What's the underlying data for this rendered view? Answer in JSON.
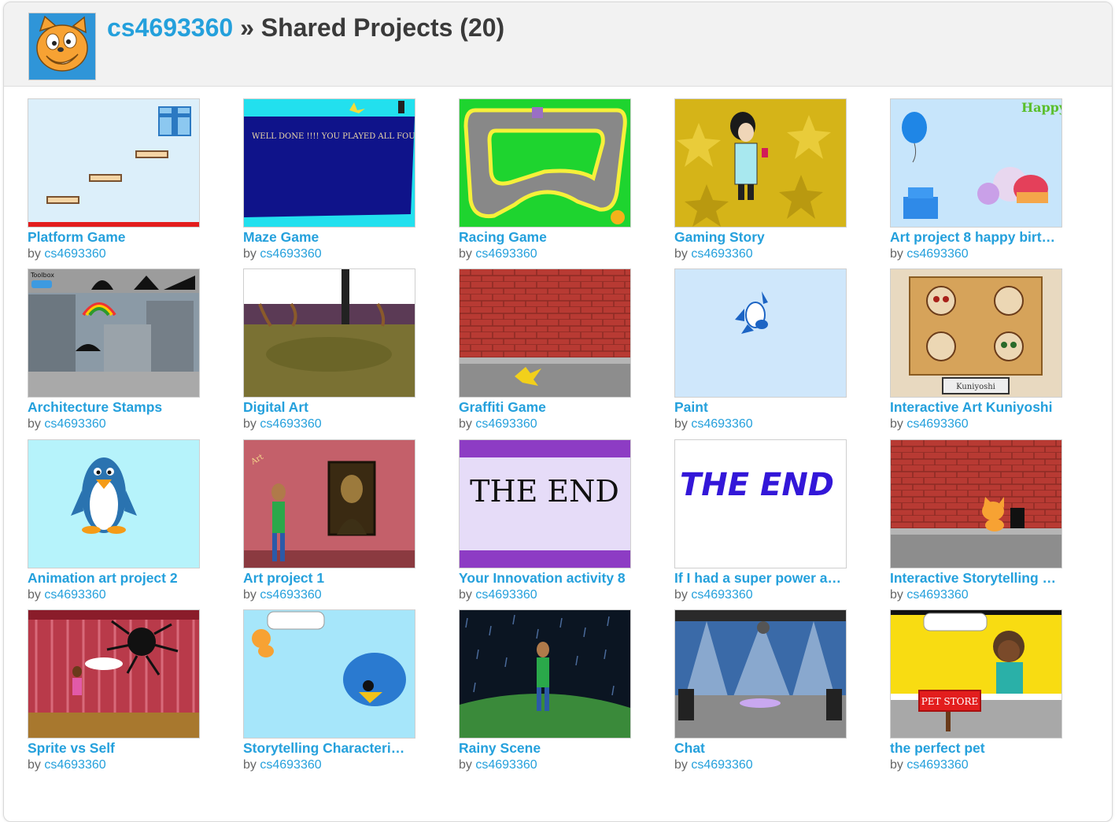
{
  "header": {
    "username": "cs4693360",
    "separator": " » ",
    "section_title": "Shared Projects (20)"
  },
  "projects": [
    {
      "title": "Platform Game",
      "by": "by",
      "owner": "cs4693360"
    },
    {
      "title": "Maze Game",
      "by": "by",
      "owner": "cs4693360",
      "thumb_text": "WELL DONE !!!! YOU PLAYED ALL FOUR LEVELS OF THE MAZE GAME"
    },
    {
      "title": "Racing Game",
      "by": "by",
      "owner": "cs4693360"
    },
    {
      "title": "Gaming Story",
      "by": "by",
      "owner": "cs4693360"
    },
    {
      "title": "Art project 8 happy birt…",
      "by": "by",
      "owner": "cs4693360",
      "thumb_text": "Happy"
    },
    {
      "title": "Architecture Stamps",
      "by": "by",
      "owner": "cs4693360",
      "thumb_text": "Toolbox"
    },
    {
      "title": "Digital Art",
      "by": "by",
      "owner": "cs4693360"
    },
    {
      "title": "Graffiti Game",
      "by": "by",
      "owner": "cs4693360"
    },
    {
      "title": "Paint",
      "by": "by",
      "owner": "cs4693360"
    },
    {
      "title": "Interactive Art Kuniyoshi",
      "by": "by",
      "owner": "cs4693360",
      "thumb_text": "Kuniyoshi"
    },
    {
      "title": "Animation art project 2",
      "by": "by",
      "owner": "cs4693360"
    },
    {
      "title": "Art project 1",
      "by": "by",
      "owner": "cs4693360",
      "thumb_text": "Art"
    },
    {
      "title": "Your Innovation activity 8",
      "by": "by",
      "owner": "cs4693360",
      "thumb_text": "THE END"
    },
    {
      "title": "If I had a super power a…",
      "by": "by",
      "owner": "cs4693360",
      "thumb_text": "THE END"
    },
    {
      "title": "Interactive Storytelling …",
      "by": "by",
      "owner": "cs4693360"
    },
    {
      "title": "Sprite vs Self",
      "by": "by",
      "owner": "cs4693360"
    },
    {
      "title": "Storytelling Characteri…",
      "by": "by",
      "owner": "cs4693360"
    },
    {
      "title": "Rainy Scene",
      "by": "by",
      "owner": "cs4693360"
    },
    {
      "title": "Chat",
      "by": "by",
      "owner": "cs4693360"
    },
    {
      "title": "the perfect pet",
      "by": "by",
      "owner": "cs4693360",
      "thumb_text": "PET STORE"
    }
  ],
  "colors": {
    "link": "#24a0dc",
    "title_text": "#3a3a3a",
    "byline": "#666666",
    "header_bg": "#f2f2f2"
  }
}
